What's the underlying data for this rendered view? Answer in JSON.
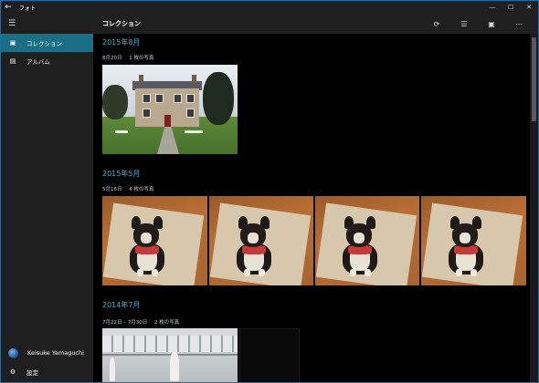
{
  "window": {
    "title": "フォト",
    "back_glyph": "←",
    "controls": [
      "—",
      "☐",
      "✕"
    ]
  },
  "sidebar": {
    "menu_glyph": "☰",
    "items": [
      {
        "label": "コレクション",
        "icon": "collection-icon",
        "active": true
      },
      {
        "label": "アルバム",
        "icon": "album-icon",
        "active": false
      }
    ],
    "user": {
      "name": "Keisuke Yamaguchi"
    },
    "settings_label": "設定"
  },
  "header": {
    "title": "コレクション",
    "icons": [
      "refresh-icon",
      "select-icon",
      "slideshow-icon",
      "more-icon"
    ]
  },
  "groups": [
    {
      "month": "2015年8月",
      "date": "8月20日",
      "count": "1 枚の写真"
    },
    {
      "month": "2015年5月",
      "date": "5月16日",
      "count": "4 枚の写真"
    },
    {
      "month": "2014年7月",
      "date": "7月22日 – 7月30日",
      "count": "2 枚の写真"
    }
  ]
}
